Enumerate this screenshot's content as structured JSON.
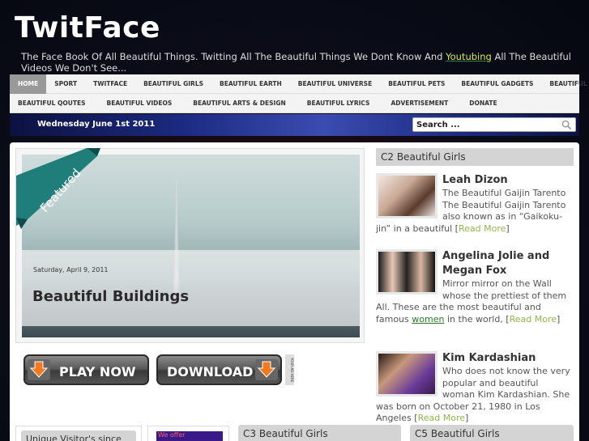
{
  "site": {
    "title": "TwitFace",
    "tagline_before": "The Face Book Of All Beautiful Things. Twitting All The Beautiful Things We Dont Know And ",
    "tagline_highlight": "Youtubing",
    "tagline_after": " All The Beautiful Videos We Don't See..."
  },
  "nav": {
    "row1": [
      "HOME",
      "SPORT",
      "TWITFACE",
      "BEAUTIFUL GIRLS",
      "BEAUTIFUL EARTH",
      "BEAUTIFUL UNIVERSE",
      "BEAUTIFUL PETS",
      "BEAUTIFUL GADGETS",
      "BEAUTIFUL NEWS"
    ],
    "row2": [
      "BEAUTIFUL QOUTES",
      "BEAUTIFUL VIDEOS",
      "BEAUTIFUL ARTS & DESIGN",
      "BEAUTIFUL LYRICS",
      "ADVERTISEMENT",
      "DONATE"
    ]
  },
  "datebar": {
    "date": "Wednesday June 1st 2011",
    "search_placeholder": "Search ..."
  },
  "featured": {
    "ribbon_label": "Featured",
    "date": "Saturday, April 9, 2011",
    "title": "Beautiful Buildings"
  },
  "cta": {
    "play_label": "PLAY NOW",
    "download_label": "DOWNLOAD",
    "tag_text": "YOUR AD HERE"
  },
  "sidebar": {
    "widget_title": "C2 Beautiful Girls",
    "posts": [
      {
        "title": "Leah Dizon",
        "text": "The Beautiful Gaijin Tarento The Beautiful Gaijin Tarento also known as in “Gaikoku-jin” in a beautiful [",
        "read_more": "Read More",
        "close": "]"
      },
      {
        "title": "Angelina Jolie and Megan Fox",
        "text": "Mirror mirror on the Wall whose the prettiest of them All. These are the most beautiful and famous ",
        "link_word": "women",
        "text2": " in the world, [",
        "read_more": "Read More",
        "close": "]"
      },
      {
        "title": "Kim Kardashian",
        "text": "Who does not know the very popular and beautiful woman Kim Kardashian. She was born on October 21, 1980 in Los Angeles [",
        "read_more": "Read More",
        "close": "]"
      }
    ]
  },
  "bottom": {
    "visitor_title": "Unique Visitor's since",
    "ad_text": "We offer",
    "c3_title": "C3 Beautiful Girls",
    "c5_title": "C5 Beautiful Girls"
  },
  "colors": {
    "nav_active": "#999999",
    "link_green": "#8fb84a",
    "datebar_blue": "#1b2a80"
  }
}
